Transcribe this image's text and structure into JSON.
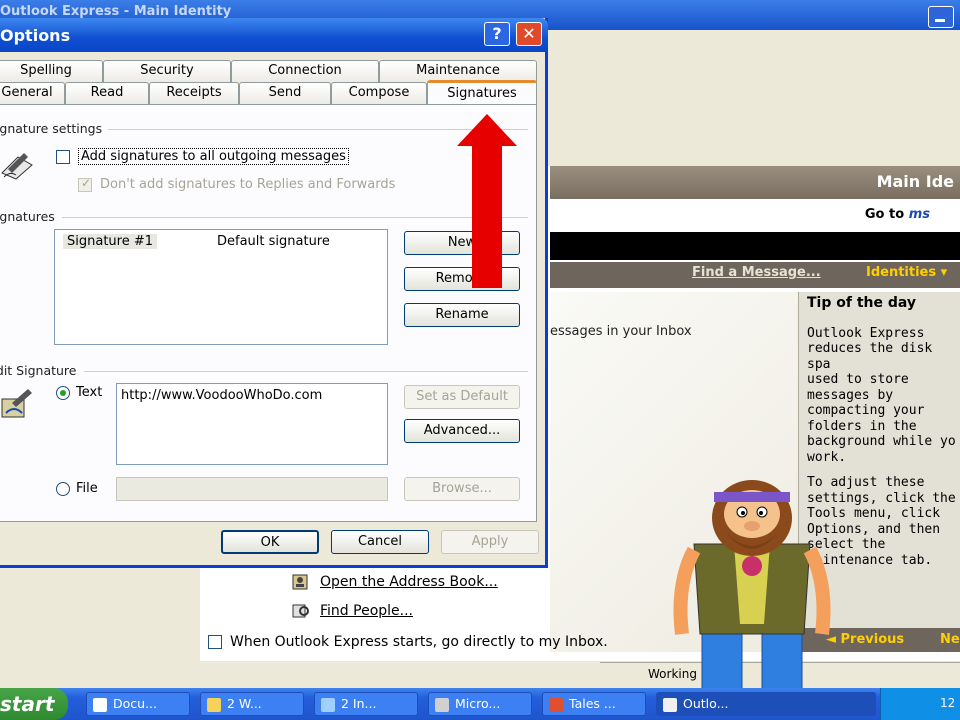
{
  "background_window": {
    "title": "Outlook Express - Main Identity",
    "main_header": "Main Ide",
    "goto_prefix": "Go to ",
    "goto_ms": "ms",
    "find_message": "Find a Message...",
    "identities": "Identities ▾",
    "messages_text": "essages in your Inbox",
    "tip_title": "Tip of the day",
    "tip_p1": "Outlook Express\nreduces the disk spa\nused to store\nmessages by\ncompacting your\nfolders in the\nbackground while yo\nwork.",
    "tip_p2": "To adjust these\nsettings, click the\nTools menu, click\nOptions, and then\nselect the\nMaintenance tab.",
    "prev": "◄ Previous",
    "next": "Ne",
    "open_address_book": "Open the Address Book...",
    "find_people": "Find People...",
    "start_checkbox": "When Outlook Express starts, go directly to my Inbox.",
    "status": "Working"
  },
  "dialog": {
    "title": "Options",
    "help": "?",
    "close": "✕",
    "tabs_top": [
      "Spelling",
      "Security",
      "Connection",
      "Maintenance"
    ],
    "tabs_bottom": [
      "General",
      "Read",
      "Receipts",
      "Send",
      "Compose",
      "Signatures"
    ],
    "active_tab": "Signatures",
    "signature_settings": {
      "group_label": "Signature settings",
      "add_all": "Add signatures to all outgoing messages",
      "dont_add": "Don't add signatures to Replies and Forwards"
    },
    "signatures": {
      "group_label": "Signatures",
      "list": [
        {
          "name": "Signature #1",
          "note": "Default signature"
        }
      ],
      "new": "New",
      "remove": "Remove",
      "rename": "Rename"
    },
    "edit_signature": {
      "group_label": "Edit Signature",
      "text_option": "Text",
      "text_value": "http://www.VoodooWhoDo.com",
      "set_default": "Set as Default",
      "advanced": "Advanced...",
      "file_option": "File",
      "browse": "Browse..."
    },
    "ok": "OK",
    "cancel": "Cancel",
    "apply": "Apply"
  },
  "taskbar": {
    "start": "start",
    "tasks": [
      "Docu...",
      "2 W...",
      "2 In...",
      "Micro...",
      "Tales ...",
      "Outlo..."
    ],
    "clock": "12"
  }
}
